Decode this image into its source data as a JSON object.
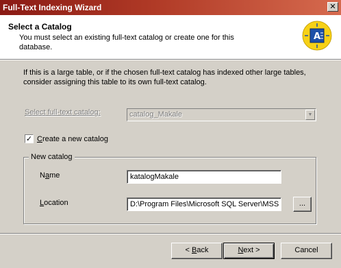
{
  "window": {
    "title": "Full-Text Indexing Wizard",
    "close_glyph": "✕"
  },
  "header": {
    "title": "Select a Catalog",
    "subtitle": "You must select an existing full-text catalog or create one for this database.",
    "icon": "wizard-catalog-icon"
  },
  "info_text": "If this is a large table, or if the chosen full-text catalog has indexed other large tables, consider assigning this table to its own full-text catalog.",
  "select_catalog": {
    "label": "Select full-text catalog:",
    "value": "catalog_Makale",
    "enabled": false
  },
  "create_new": {
    "label_pre": "",
    "label_mn": "C",
    "label_post": "reate a new catalog",
    "checked": true,
    "check_glyph": "✓"
  },
  "new_catalog": {
    "group_label": "New catalog",
    "name_label_pre": "N",
    "name_label_mn": "a",
    "name_label_post": "me",
    "name_value": "katalogMakale",
    "location_label_mn": "L",
    "location_label_post": "ocation",
    "location_value": "D:\\Program Files\\Microsoft SQL Server\\MSS",
    "browse_label": "..."
  },
  "buttons": {
    "back_pre": "< ",
    "back_mn": "B",
    "back_post": "ack",
    "next_mn": "N",
    "next_post": "ext >",
    "cancel": "Cancel"
  },
  "colors": {
    "titlebar": "#8a1a14",
    "face": "#d4d0c8",
    "icon_bg": "#f7d117",
    "icon_blue": "#1c4fa8"
  }
}
